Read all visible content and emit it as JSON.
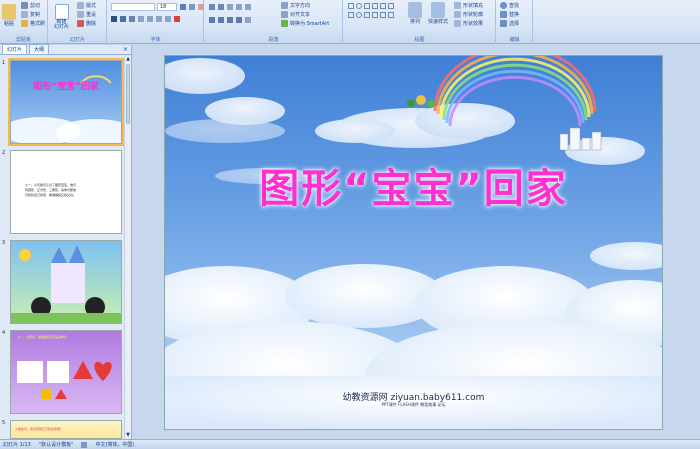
{
  "ribbon": {
    "groups": [
      {
        "label": "剪贴板"
      },
      {
        "label": "幻灯片"
      },
      {
        "label": "字体"
      },
      {
        "label": "段落"
      },
      {
        "label": "绘图"
      },
      {
        "label": "编辑"
      }
    ],
    "paste": "粘贴",
    "cut": "剪切",
    "copy": "复制",
    "format_painter": "格式刷",
    "new_slide": "新建\n幻灯片",
    "layout": "版式",
    "reset": "重设",
    "delete": "删除",
    "font_size": "18",
    "text_direction": "文字方向",
    "align_text": "对齐文本",
    "smartart": "转换为 SmartArt",
    "arrange": "排列",
    "quick_styles": "快速样式",
    "shape_fill": "形状填充",
    "shape_outline": "形状轮廓",
    "shape_effects": "形状效果",
    "find": "查找",
    "replace": "替换",
    "select": "选择"
  },
  "panel": {
    "tab_slides": "幻灯片",
    "tab_outline": "大纲",
    "close": "×",
    "thumbs": [
      {
        "num": "1",
        "title": "图形“宝宝”回家"
      },
      {
        "num": "2",
        "lines": [
          "小一，今天我们认识了图形宝宝，他们",
          "有圆形、正方形、三角形，请你们帮他",
          "们找找自己的家，看谁做得又快又好。"
        ]
      },
      {
        "num": "3"
      },
      {
        "num": "4",
        "caption": "小一，大家好，看看图形宝宝是谁呀？"
      },
      {
        "num": "5",
        "caption": "小朋友们，我们来帮它们找找家吧！"
      }
    ]
  },
  "slide": {
    "title": "图形“宝宝”回家",
    "footer": "幼教资源网 ziyuan.baby611.com",
    "sub": "PPT课件   FLASH课件   教案故事   论坛"
  },
  "status": {
    "slide_count": "幻灯片 1/13",
    "theme": "\"默认设计模板\"",
    "language": "中文(简体，中国)"
  },
  "colors": {
    "title": "#ff2fd0",
    "sky_top": "#4f8fe0",
    "sky_bottom": "#bcd8f7"
  }
}
